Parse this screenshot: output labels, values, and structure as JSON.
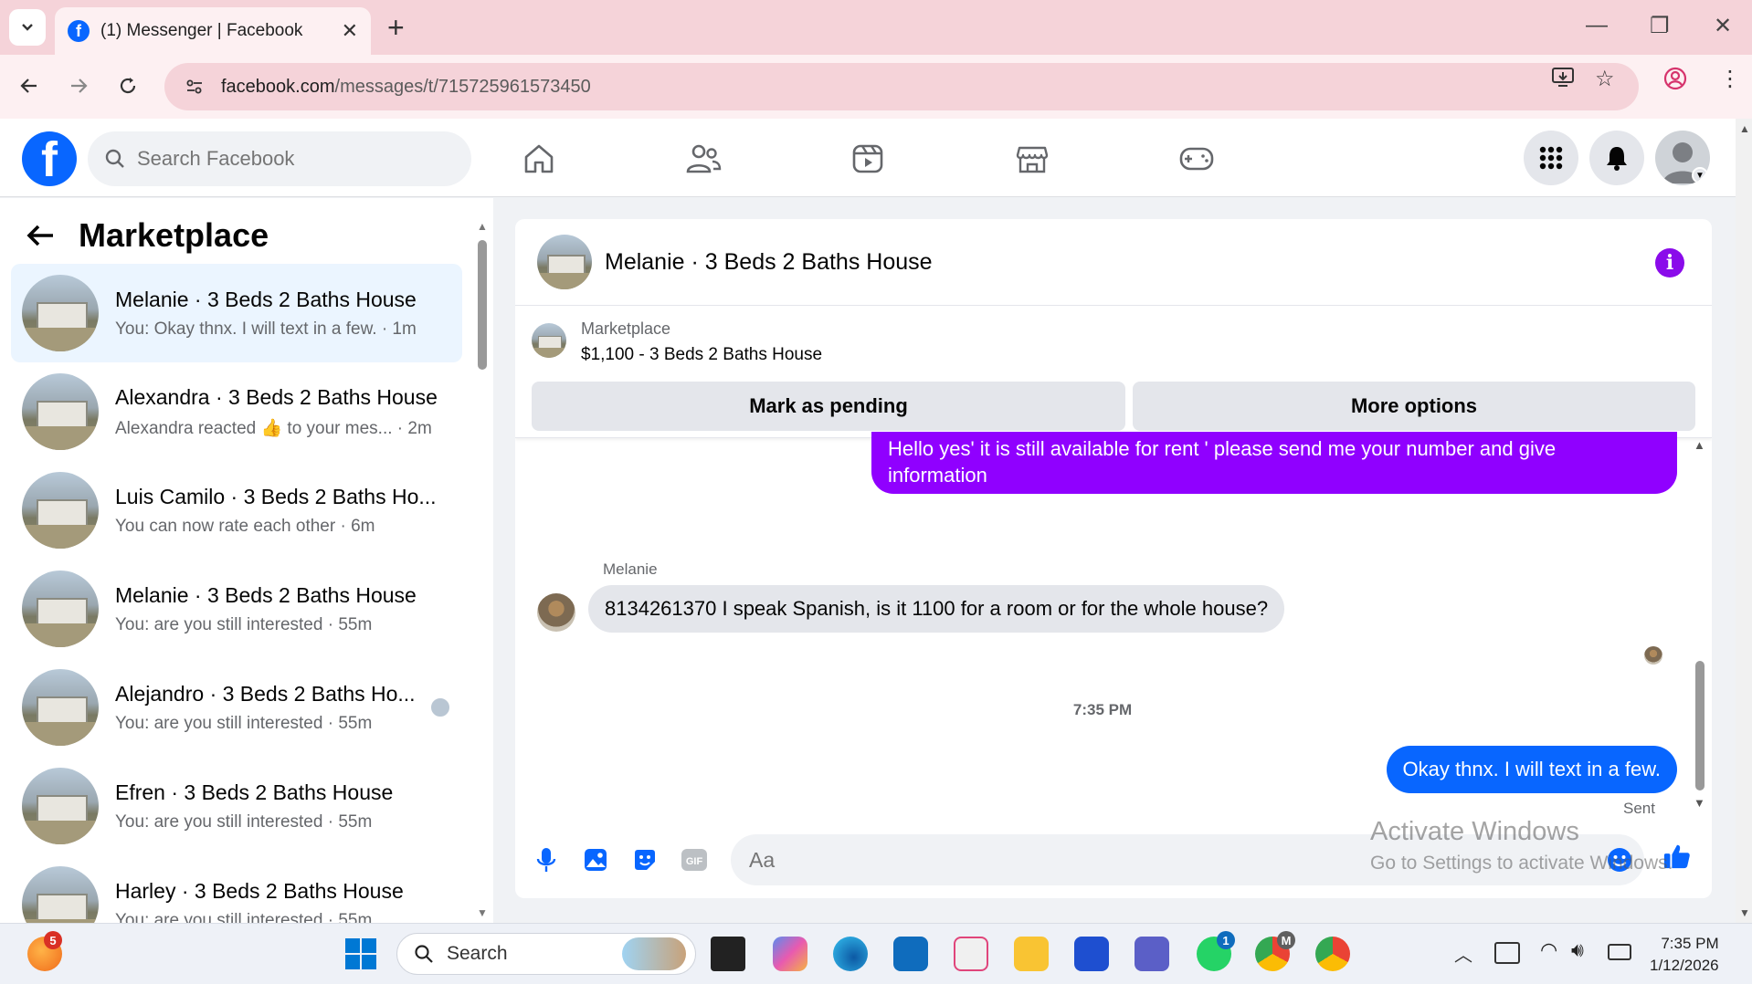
{
  "browser": {
    "tab_title": "(1) Messenger | Facebook",
    "url_domain": "facebook.com",
    "url_path": "/messages/t/715725961573450"
  },
  "fb": {
    "search_placeholder": "Search Facebook"
  },
  "left_pane": {
    "title": "Marketplace",
    "conversations": [
      {
        "name": "Melanie · 3 Beds 2 Baths House",
        "preview": "You: Okay thnx. I will text in a few. · 1m",
        "active": true
      },
      {
        "name": "Alexandra · 3 Beds 2 Baths House",
        "preview": "Alexandra reacted 👍 to your mes... · 2m"
      },
      {
        "name": "Luis Camilo · 3 Beds 2 Baths Ho...",
        "preview": "You can now rate each other · 6m"
      },
      {
        "name": "Melanie · 3 Beds 2 Baths House",
        "preview": "You: are you still interested · 55m"
      },
      {
        "name": "Alejandro · 3 Beds 2 Baths Ho...",
        "preview": "You: are you still interested · 55m"
      },
      {
        "name": "Efren · 3 Beds 2 Baths House",
        "preview": "You: are you still interested · 55m"
      },
      {
        "name": "Harley · 3 Beds 2 Baths House",
        "preview": "You: are you still interested · 55m"
      }
    ]
  },
  "chat": {
    "title": "Melanie · 3 Beds 2 Baths House",
    "marketplace_label": "Marketplace",
    "listing": "$1,100 - 3 Beds 2 Baths House",
    "mark_pending_label": "Mark as pending",
    "more_options_label": "More options",
    "msg_out_1": "Hello yes' it is still available for rent ' please send me your number and give information",
    "sender_name": "Melanie",
    "msg_in_1": "8134261370 I speak Spanish, is it 1100 for a room or for the whole house?",
    "timestamp": "7:35 PM",
    "msg_out_2": "Okay thnx. I will text in a few.",
    "sent_label": "Sent",
    "composer_placeholder": "Aa"
  },
  "watermark": {
    "line1": "Activate Windows",
    "line2": "Go to Settings to activate Windows."
  },
  "taskbar": {
    "search_label": "Search",
    "time": "7:35 PM",
    "date": "1/12/2026",
    "badges": {
      "weather": "5",
      "whatsapp": "1",
      "chrome_m": "M"
    }
  },
  "colors": {
    "fb_blue": "#0866ff",
    "purple_bubble": "#9000ff",
    "info_purple": "#8a0bea"
  }
}
